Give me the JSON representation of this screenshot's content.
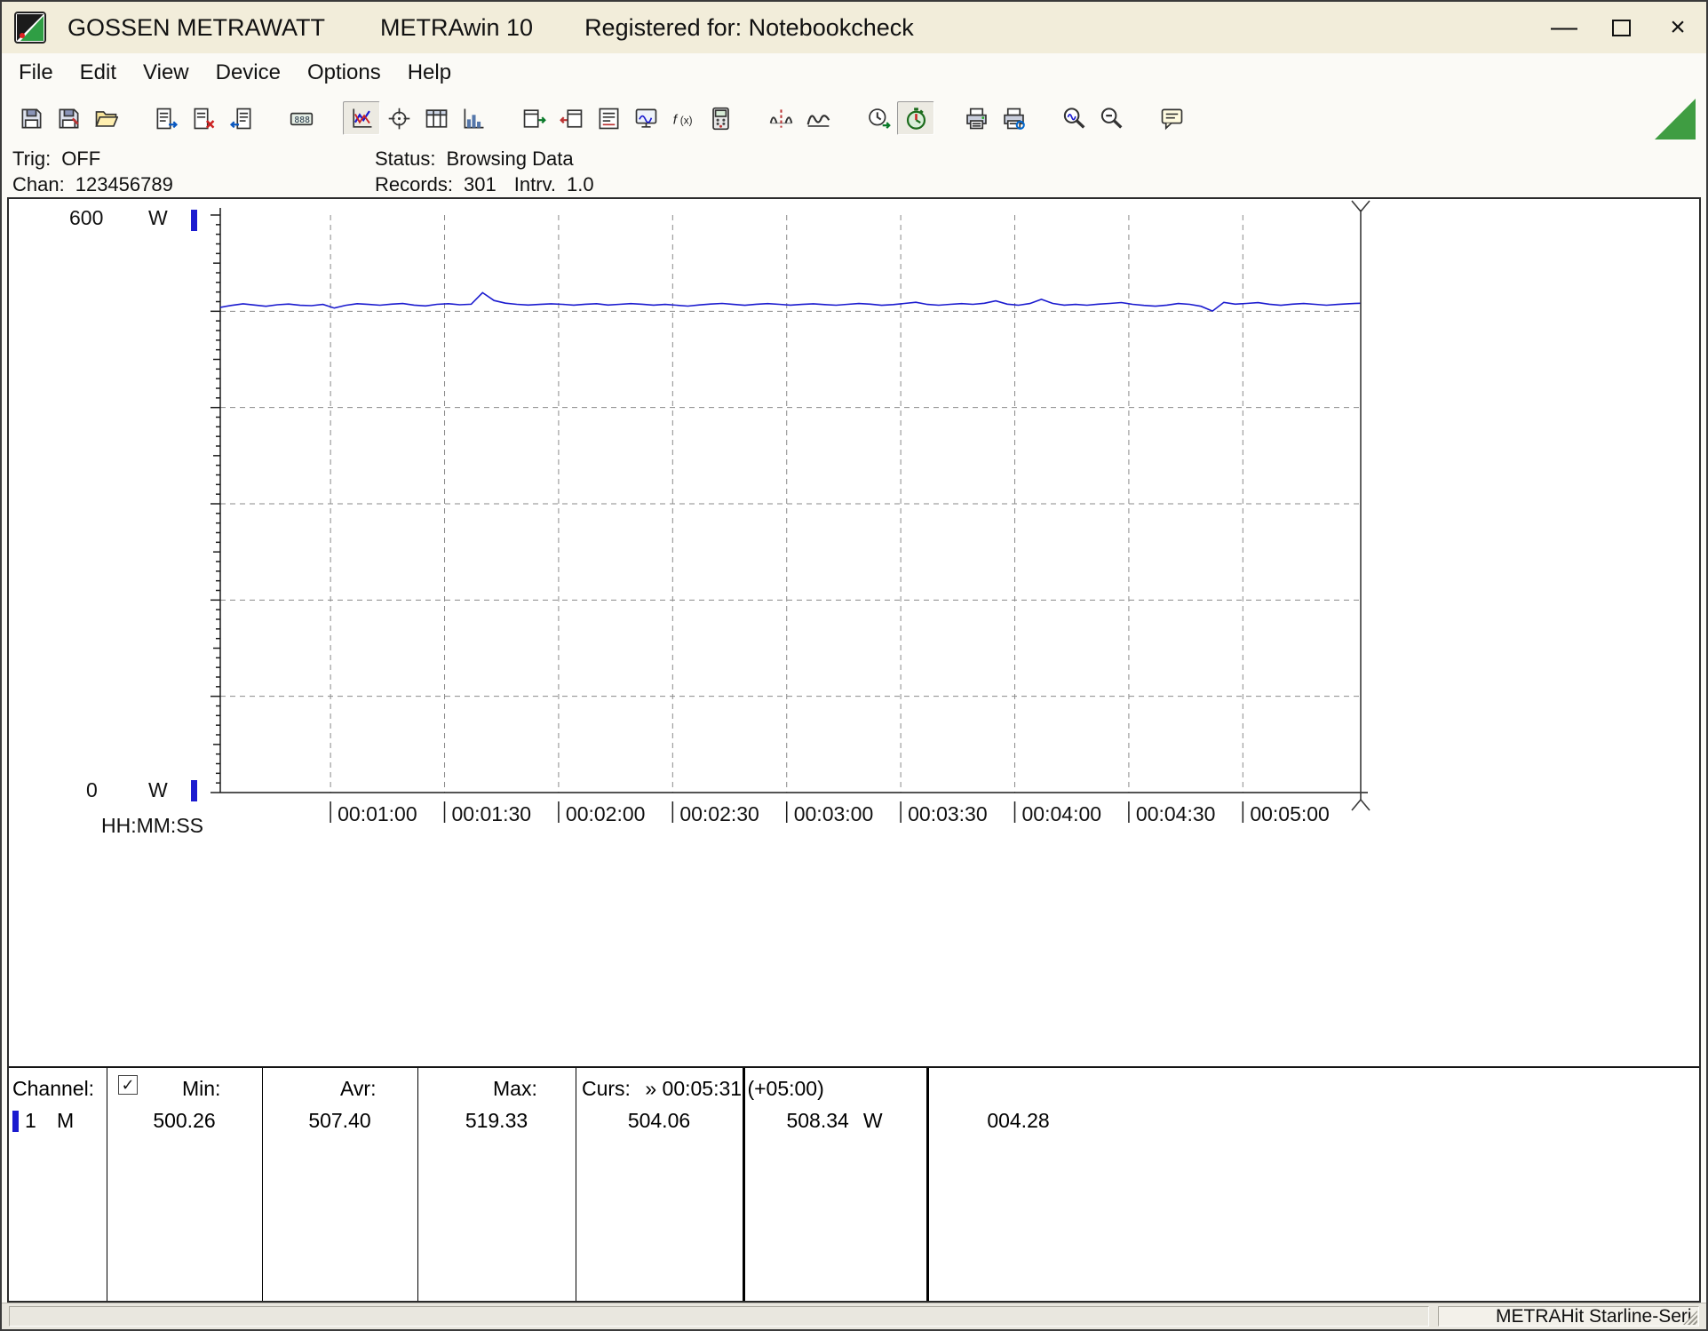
{
  "window": {
    "brand": "GOSSEN METRAWATT",
    "app_name": "METRAwin 10",
    "registered": "Registered for: Notebookcheck",
    "controls": [
      {
        "name": "minimize",
        "glyph": "—"
      },
      {
        "name": "maximize",
        "glyph": ""
      },
      {
        "name": "close",
        "glyph": "×"
      }
    ]
  },
  "menu": {
    "items": [
      "File",
      "Edit",
      "View",
      "Device",
      "Options",
      "Help"
    ]
  },
  "toolbar": {
    "groups": [
      {
        "buttons": [
          {
            "name": "save-button",
            "icon": "floppy"
          },
          {
            "name": "save-as-button",
            "icon": "floppy2"
          },
          {
            "name": "open-file-button",
            "icon": "folder"
          }
        ]
      },
      {
        "buttons": [
          {
            "name": "export-data-button",
            "icon": "doc-out"
          },
          {
            "name": "delete-data-button",
            "icon": "doc-del"
          },
          {
            "name": "import-data-button",
            "icon": "doc-in"
          }
        ]
      },
      {
        "buttons": [
          {
            "name": "numeric-display-button",
            "icon": "display"
          }
        ]
      },
      {
        "buttons": [
          {
            "name": "chart-view-button",
            "icon": "linechart",
            "pressed": true
          },
          {
            "name": "cursor-tool-button",
            "icon": "crosshair"
          },
          {
            "name": "table-view-button",
            "icon": "table"
          },
          {
            "name": "histogram-view-button",
            "icon": "hist"
          }
        ]
      },
      {
        "buttons": [
          {
            "name": "read-device-button",
            "icon": "win-out"
          },
          {
            "name": "write-device-button",
            "icon": "win-in"
          },
          {
            "name": "protocol-button",
            "icon": "protocol"
          },
          {
            "name": "online-monitor-button",
            "icon": "monitor"
          },
          {
            "name": "formula-button",
            "icon": "fx"
          },
          {
            "name": "device-display-button",
            "icon": "device"
          }
        ]
      },
      {
        "buttons": [
          {
            "name": "split-curve-button",
            "icon": "wave-cut"
          },
          {
            "name": "envelope-curve-button",
            "icon": "wave"
          }
        ]
      },
      {
        "buttons": [
          {
            "name": "time-sync-button",
            "icon": "clock-out"
          },
          {
            "name": "record-timer-button",
            "icon": "timer",
            "pressed": true
          }
        ]
      },
      {
        "buttons": [
          {
            "name": "print-button",
            "icon": "printer"
          },
          {
            "name": "print-preview-button",
            "icon": "printer2"
          }
        ]
      },
      {
        "buttons": [
          {
            "name": "zoom-in-button",
            "icon": "zoom-wave"
          },
          {
            "name": "zoom-out-button",
            "icon": "zoom-out"
          }
        ]
      },
      {
        "buttons": [
          {
            "name": "annotation-button",
            "icon": "notes"
          }
        ]
      }
    ]
  },
  "status_panel": {
    "trig_label": "Trig:",
    "trig_value": "OFF",
    "chan_label": "Chan:",
    "chan_value": "123456789",
    "status_label": "Status:",
    "status_value": "Browsing Data",
    "records_label": "Records:",
    "records_value": "301",
    "intrv_label": "Intrv.",
    "intrv_value": "1.0"
  },
  "chart_data": {
    "type": "line",
    "title": "",
    "ylabel_top": "600",
    "ylabel_bottom": "0",
    "y_unit": "W",
    "ylim": [
      0,
      600
    ],
    "x_axis_label": "HH:MM:SS",
    "x_range_seconds": [
      31,
      331
    ],
    "grid_y_values": [
      100,
      200,
      300,
      400,
      500
    ],
    "grid": true,
    "x_ticks": [
      {
        "t": 60,
        "label": "00:01:00"
      },
      {
        "t": 90,
        "label": "00:01:30"
      },
      {
        "t": 120,
        "label": "00:02:00"
      },
      {
        "t": 150,
        "label": "00:02:30"
      },
      {
        "t": 180,
        "label": "00:03:00"
      },
      {
        "t": 210,
        "label": "00:03:30"
      },
      {
        "t": 240,
        "label": "00:04:00"
      },
      {
        "t": 270,
        "label": "00:04:30"
      },
      {
        "t": 300,
        "label": "00:05:00"
      }
    ],
    "cursor": {
      "x_seconds": 331,
      "time_label": "00:05:31",
      "value": "508.34"
    },
    "series": [
      {
        "name": "channel-1",
        "unit": "W",
        "color": "#1b1bcf",
        "x_start": 31,
        "x_step": 3,
        "values": [
          504.06,
          506.1,
          507.8,
          506.5,
          505.2,
          506.8,
          507.5,
          506.2,
          505.8,
          507.1,
          503.4,
          506.2,
          507.9,
          507.1,
          506.3,
          507.4,
          508.1,
          506.4,
          505.6,
          507.2,
          507.9,
          506.8,
          507.3,
          519.33,
          511.2,
          508.4,
          507.2,
          506.5,
          507.1,
          507.8,
          507.2,
          506.4,
          507.3,
          507.9,
          506.5,
          507.2,
          508.0,
          507.3,
          506.4,
          507.1,
          506.3,
          505.4,
          506.6,
          507.5,
          508.2,
          507.1,
          506.2,
          507.3,
          508.0,
          507.2,
          506.4,
          507.1,
          507.8,
          507.0,
          506.3,
          507.2,
          508.1,
          507.4,
          506.2,
          507.0,
          508.2,
          509.4,
          507.1,
          506.3,
          507.2,
          508.0,
          507.2,
          508.3,
          510.8,
          507.4,
          506.3,
          508.1,
          512.4,
          508.2,
          506.4,
          507.1,
          506.3,
          507.4,
          508.2,
          509.1,
          507.2,
          506.1,
          505.3,
          506.4,
          508.1,
          507.2,
          505.2,
          500.26,
          509.3,
          507.4,
          508.2,
          509.0,
          507.3,
          506.2,
          507.4,
          508.1,
          507.2,
          506.3,
          507.1,
          507.9,
          508.34
        ]
      }
    ]
  },
  "table": {
    "channel_label": "Channel:",
    "checkbox_glyph": "✓",
    "col_headers": {
      "min": "Min:",
      "avr": "Avr:",
      "max": "Max:"
    },
    "cursor_header_label": "Curs:",
    "cursor_header_value": "» 00:05:31 (+05:00)",
    "row": {
      "channel": "1",
      "mode": "M",
      "min": "500.26",
      "avr": "507.40",
      "max": "519.33",
      "cursor1": "504.06",
      "cursor2": "508.34",
      "unit": "W",
      "delta": "004.28",
      "marker_color": "#1b1bcf"
    }
  },
  "statusbar": {
    "device": "METRAHit Starline-Seri"
  },
  "colors": {
    "titlebar": "#f2edda",
    "trace_blue": "#1b1bcf",
    "corner_green": "#3f9d42"
  }
}
